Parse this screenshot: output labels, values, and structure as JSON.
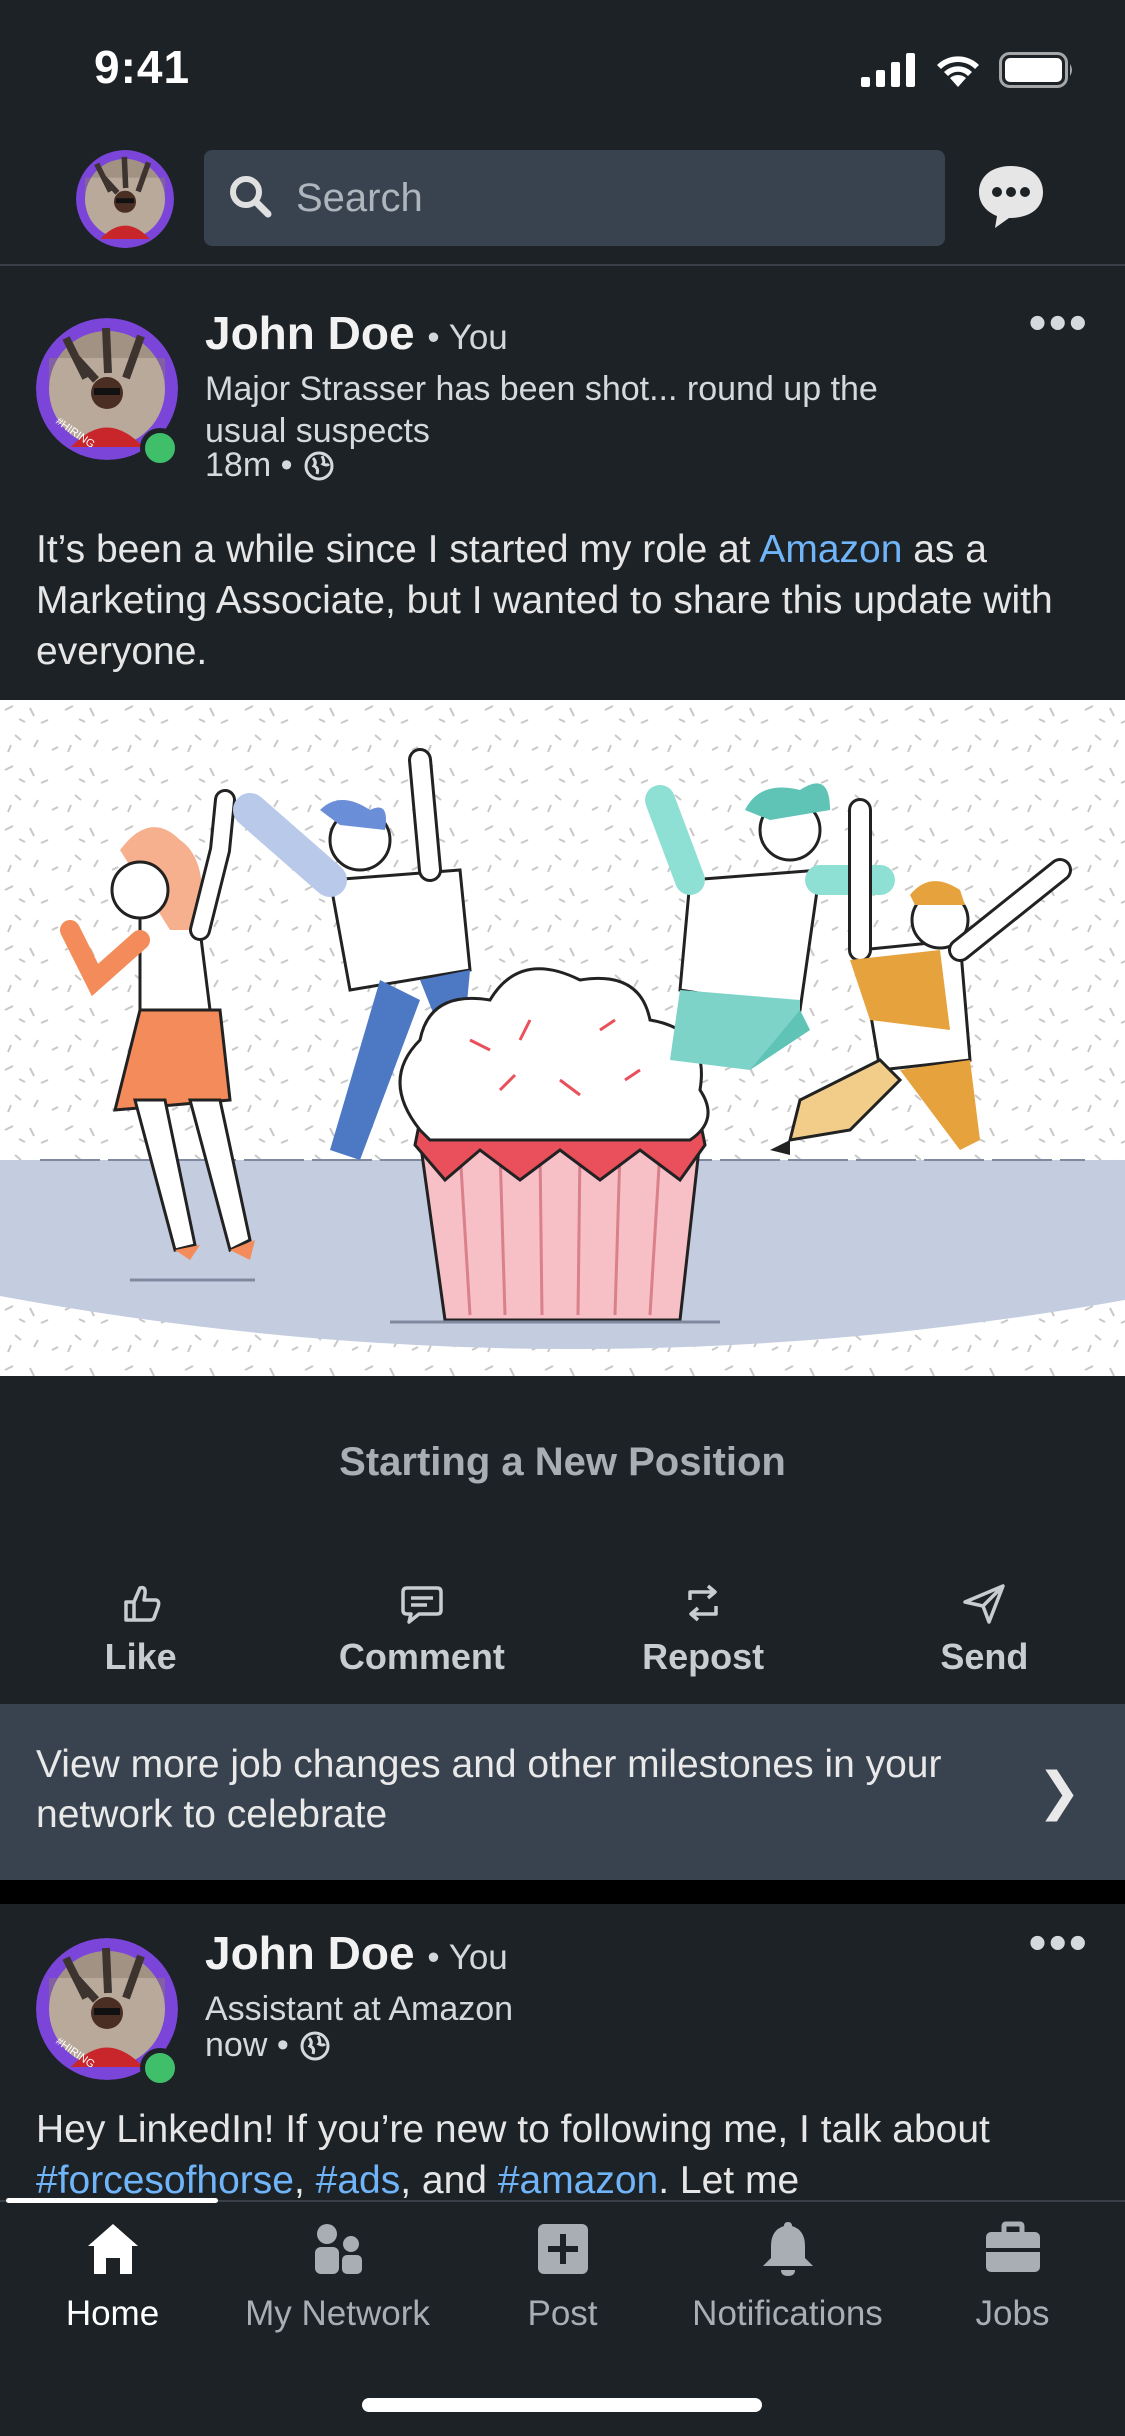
{
  "status": {
    "time": "9:41"
  },
  "search": {
    "placeholder": "Search"
  },
  "posts": [
    {
      "name": "John Doe",
      "you": "• You",
      "headline": "Major Strasser has been shot... round up the usual suspects",
      "time": "18m •",
      "text_before": "It’s been a while since I started my role at ",
      "text_link": "Amazon",
      "text_after": " as a Marketing Associate, but I wanted to share this update with everyone.",
      "caption": "Starting a New Position"
    },
    {
      "name": "John Doe",
      "you": "• You",
      "headline": "Assistant at Amazon",
      "time": "now •",
      "text_1": "Hey LinkedIn! If you’re new to following me, I talk about ",
      "tag_1": "#forcesofhorse",
      "sep_1": ", ",
      "tag_2": "#ads",
      "sep_2": ", and ",
      "tag_3": "#amazon",
      "text_2": ". Let me"
    }
  ],
  "actions": [
    {
      "label": "Like",
      "icon": "like-icon"
    },
    {
      "label": "Comment",
      "icon": "comment-icon"
    },
    {
      "label": "Repost",
      "icon": "repost-icon"
    },
    {
      "label": "Send",
      "icon": "send-icon"
    }
  ],
  "milestone": {
    "text": "View more job changes and other milestones in your network to celebrate",
    "chevron": "❯"
  },
  "avatar_badge": "#HIRING",
  "tabs": [
    {
      "label": "Home",
      "icon": "home-icon",
      "active": true
    },
    {
      "label": "My Network",
      "icon": "network-icon",
      "active": false
    },
    {
      "label": "Post",
      "icon": "post-icon",
      "active": false
    },
    {
      "label": "Notifications",
      "icon": "bell-icon",
      "active": false
    },
    {
      "label": "Jobs",
      "icon": "briefcase-icon",
      "active": false
    }
  ],
  "colors": {
    "background": "#1d2226",
    "surface": "#38434f",
    "link": "#70b5f9",
    "online": "#3fbf6a",
    "hiring_ring": "#8a3ffc"
  }
}
